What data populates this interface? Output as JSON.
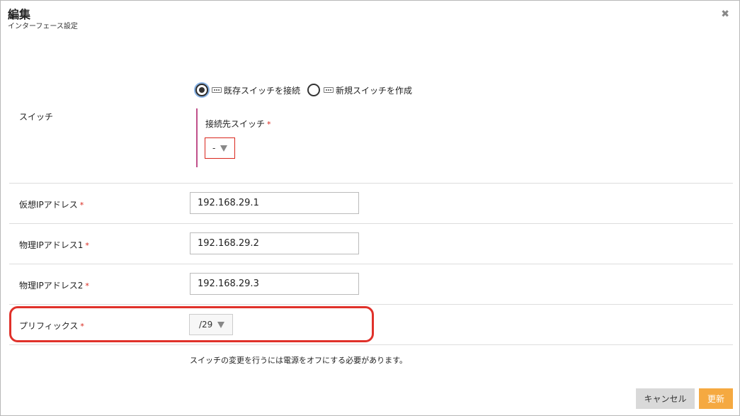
{
  "dialog": {
    "title": "編集",
    "subtitle": "インターフェース設定",
    "close_icon": "close-icon",
    "close_glyph": "✖"
  },
  "switch_section": {
    "label": "スイッチ",
    "options": [
      {
        "label": "既存スイッチを接続",
        "checked": true,
        "icon": "switch-icon"
      },
      {
        "label": "新規スイッチを作成",
        "checked": false,
        "icon": "switch-icon"
      }
    ],
    "target_switch": {
      "label": "接続先スイッチ",
      "required_mark": "*",
      "selected": "-"
    }
  },
  "fields": {
    "virtual_ip": {
      "label": "仮想IPアドレス",
      "required_mark": "*",
      "value": "192.168.29.1"
    },
    "physical_ip1": {
      "label": "物理IPアドレス1",
      "required_mark": "*",
      "value": "192.168.29.2"
    },
    "physical_ip2": {
      "label": "物理IPアドレス2",
      "required_mark": "*",
      "value": "192.168.29.3"
    },
    "prefix": {
      "label": "プリフィックス",
      "required_mark": "*",
      "selected": "/29"
    }
  },
  "notice": "スイッチの変更を行うには電源をオフにする必要があります。",
  "buttons": {
    "cancel": "キャンセル",
    "update": "更新"
  },
  "colors": {
    "required": "#d9261c",
    "highlight": "#e0312a",
    "update_button": "#f5a941",
    "subsection_bar": "#c0508a"
  }
}
